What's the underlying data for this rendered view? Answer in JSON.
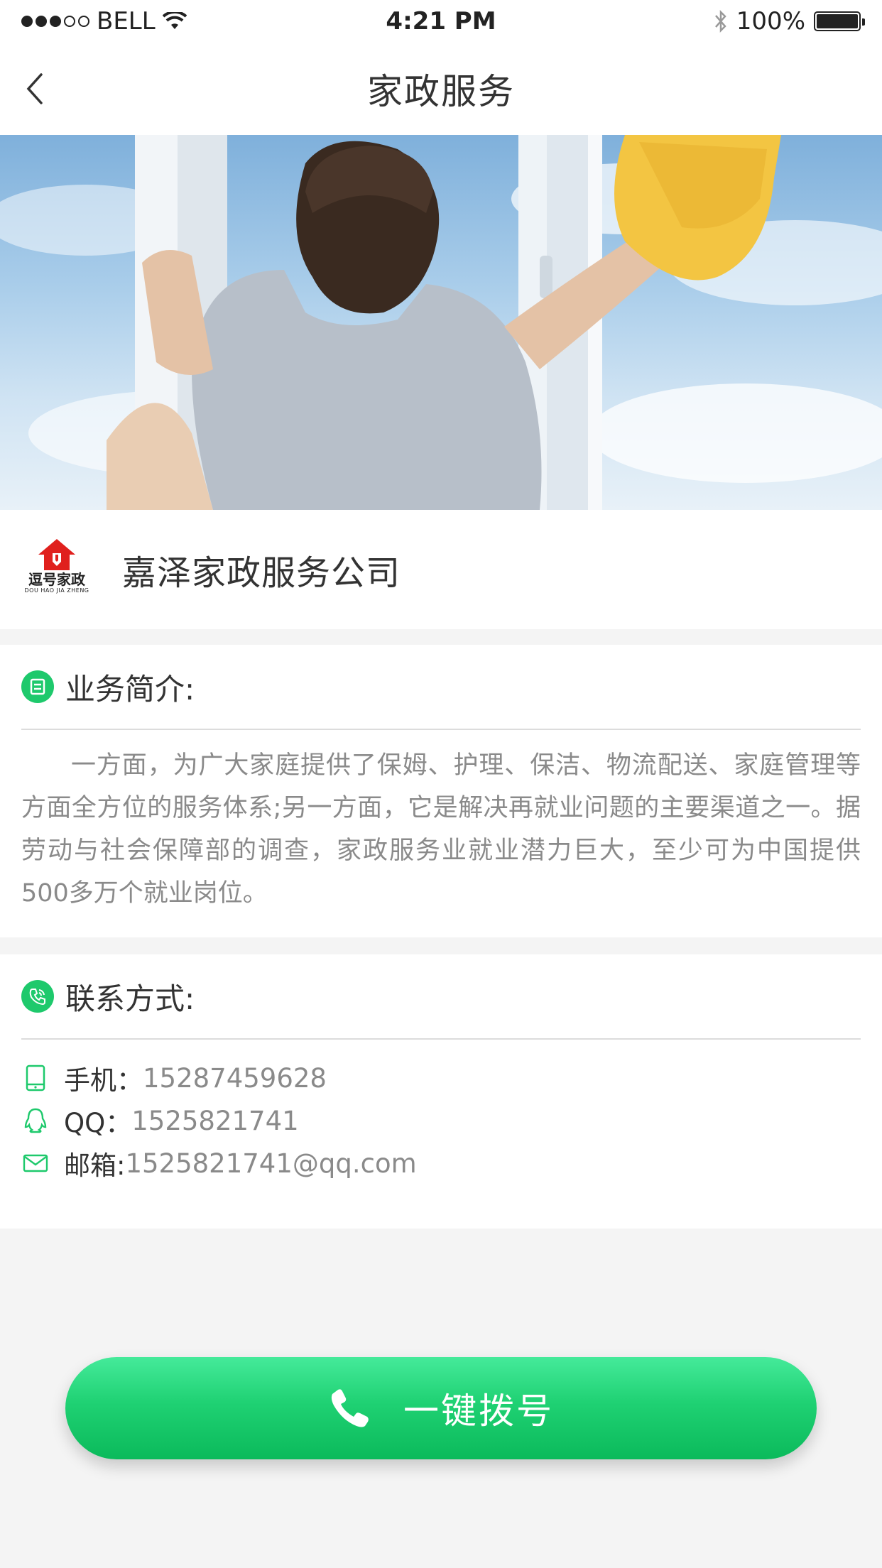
{
  "status_bar": {
    "carrier": "BELL",
    "time": "4:21 PM",
    "battery": "100%"
  },
  "nav": {
    "title": "家政服务"
  },
  "company": {
    "logo_text": "逗号家政",
    "logo_sub": "DOU HAO JIA ZHENG",
    "name": "嘉泽家政服务公司"
  },
  "intro": {
    "title": "业务简介:",
    "text": "一方面，为广大家庭提供了保姆、护理、保洁、物流配送、家庭管理等方面全方位的服务体系;另一方面，它是解决再就业问题的主要渠道之一。据劳动与社会保障部的调查，家政服务业就业潜力巨大，至少可为中国提供500多万个就业岗位。"
  },
  "contact": {
    "title": "联系方式:",
    "items": [
      {
        "label": "手机：",
        "value": "15287459628",
        "icon": "phone-icon"
      },
      {
        "label": "QQ：",
        "value": "1525821741",
        "icon": "qq-icon"
      },
      {
        "label": "邮箱:",
        "value": "1525821741@qq.com",
        "icon": "mail-icon"
      }
    ]
  },
  "call_button": {
    "label": "一键拨号"
  },
  "colors": {
    "accent": "#1ec96c",
    "background": "#f4f4f4"
  }
}
